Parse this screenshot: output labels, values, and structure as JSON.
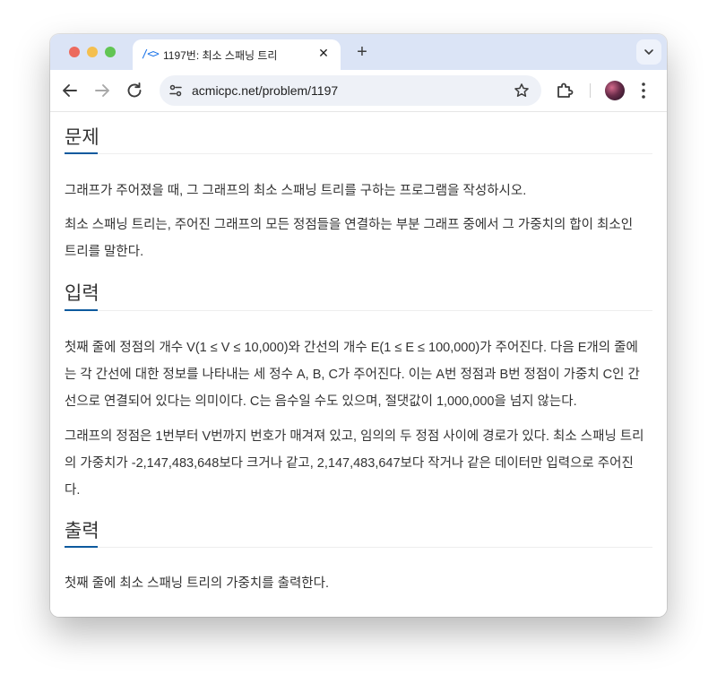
{
  "browser": {
    "tab": {
      "favicon": "/<>",
      "title": "1197번: 최소 스패닝 트리",
      "close_glyph": "✕"
    },
    "new_tab_glyph": "+",
    "tab_search_glyph": "⌄",
    "address": {
      "url": "acmicpc.net/problem/1197"
    },
    "icons": {
      "back": "back-arrow-icon",
      "forward": "forward-arrow-icon",
      "reload": "reload-icon",
      "site_info": "tune-icon",
      "bookmark": "star-icon",
      "extensions": "puzzle-icon",
      "profile": "avatar",
      "menu": "kebab-menu-icon"
    },
    "colors": {
      "tabstrip": "#dbe4f6",
      "omnibox": "#eef1f7",
      "accent": "#0d5a9e"
    }
  },
  "problem": {
    "description": {
      "heading": "문제",
      "paragraphs": [
        "그래프가 주어졌을 때, 그 그래프의 최소 스패닝 트리를 구하는 프로그램을 작성하시오.",
        "최소 스패닝 트리는, 주어진 그래프의 모든 정점들을 연결하는 부분 그래프 중에서 그 가중치의 합이 최소인 트리를 말한다."
      ]
    },
    "input": {
      "heading": "입력",
      "paragraphs": [
        "첫째 줄에 정점의 개수 V(1 ≤ V ≤ 10,000)와 간선의 개수 E(1 ≤ E ≤ 100,000)가 주어진다. 다음 E개의 줄에는 각 간선에 대한 정보를 나타내는 세 정수 A, B, C가 주어진다. 이는 A번 정점과 B번 정점이 가중치 C인 간선으로 연결되어 있다는 의미이다. C는 음수일 수도 있으며, 절댓값이 1,000,000을 넘지 않는다.",
        "그래프의 정점은 1번부터 V번까지 번호가 매겨져 있고, 임의의 두 정점 사이에 경로가 있다. 최소 스패닝 트리의 가중치가 -2,147,483,648보다 크거나 같고, 2,147,483,647보다 작거나 같은 데이터만 입력으로 주어진다."
      ]
    },
    "output": {
      "heading": "출력",
      "paragraphs": [
        "첫째 줄에 최소 스패닝 트리의 가중치를 출력한다."
      ]
    }
  }
}
